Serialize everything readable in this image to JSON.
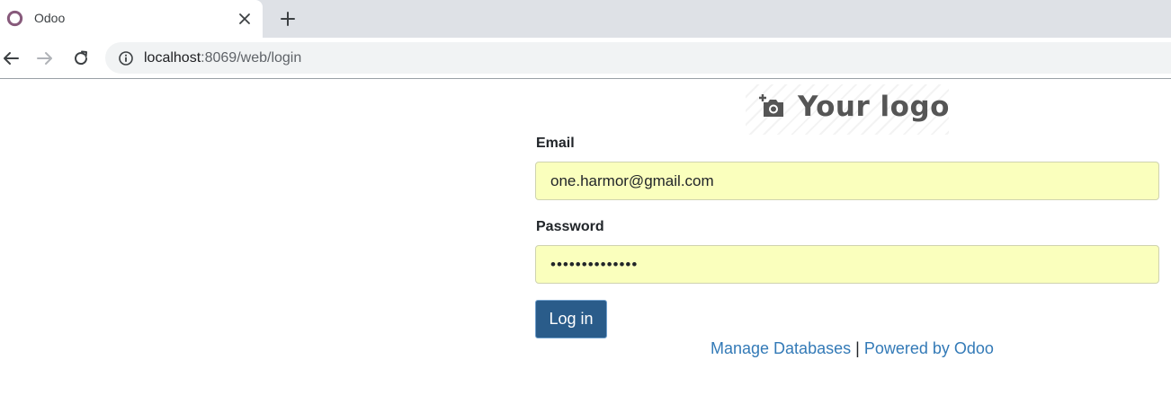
{
  "browser": {
    "tab_title": "Odoo",
    "url_host": "localhost",
    "url_rest": ":8069/web/login",
    "favicon_color": "#875a7b"
  },
  "logo": {
    "text": "Your logo",
    "icon": "add-photo-icon"
  },
  "form": {
    "email_label": "Email",
    "email_value": "one.harmor@gmail.com",
    "password_label": "Password",
    "password_value": "••••••••••••••",
    "login_label": "Log in",
    "autofill_color": "#faffbd",
    "button_color": "#2a5c8a"
  },
  "footer": {
    "manage_label": "Manage Databases",
    "separator": "|",
    "powered_label": "Powered by Odoo",
    "link_color": "#337ab7"
  }
}
